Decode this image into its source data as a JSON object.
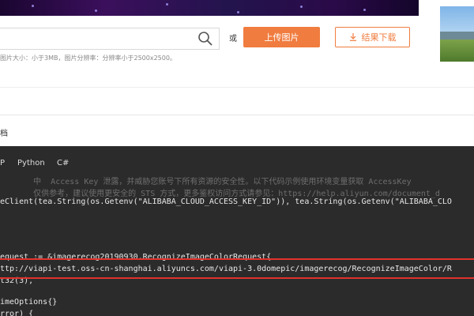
{
  "header": {
    "or_label": "或",
    "upload_button": "上传图片",
    "download_button": "结果下载",
    "hint": "图片大小：小于3MB，图片分辨率：分辨率小于2500x2500。"
  },
  "section": {
    "tab_label": "档"
  },
  "code_panel": {
    "lang_tabs": [
      "P",
      "Python",
      "C#"
    ],
    "lines": [
      "       中  Access Key 泄露，并威胁您账号下所有资源的安全性。以下代码示例使用环境变量获取 AccessKey",
      "       仅供参考，建议使用更安全的 STS 方式，更多鉴权访问方式请参见：https://help.aliyun.com/document_d",
      "eClient(tea.String(os.Getenv(\"ALIBABA_CLOUD_ACCESS_KEY_ID\")), tea.String(os.Getenv(\"ALIBABA_CLO",
      "equest := &imagerecog20190930.RecognizeImageColorRequest{",
      "ttp://viapi-test.oss-cn-shanghai.aliyuncs.com/viapi-3.0domepic/imagerecog/RecognizeImageColor/R",
      "t32(3),",
      "imeOptions{}",
      "rror) {"
    ]
  },
  "colors": {
    "accent": "#f07c3f",
    "code_bg": "#2b2b2b",
    "highlight": "#e0322c"
  }
}
